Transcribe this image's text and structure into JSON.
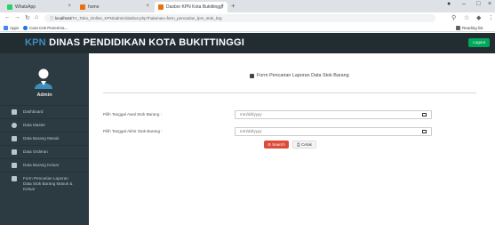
{
  "browser": {
    "tabs": [
      {
        "label": "WhatsApp",
        "favicon_color": "#25d366"
      },
      {
        "label": "home",
        "favicon_color": "#e8710a"
      },
      {
        "label": "Dasbor KPN Kota Bukittinggi",
        "favicon_color": "#e8710a"
      }
    ],
    "url_host": "localhost",
    "url_path": "/TA_Toko_Online_KPN/admin/dasbor.php?halaman=form_pencarian_lpm_stok_brg",
    "bookmarks": [
      {
        "label": "Apps",
        "color": "#4285f4"
      },
      {
        "label": "Cara Cek Penerima...",
        "color": "#1a73e8"
      }
    ],
    "reading_list": "Reading list"
  },
  "header": {
    "brand_prefix": "KPN",
    "brand_rest": " DINAS PENDIDIKAN KOTA BUKITTINGGI",
    "logout_label": "Logout"
  },
  "sidebar": {
    "user_name": "Admin",
    "items": [
      {
        "label": "Dashboard",
        "icon": "dashboard-icon"
      },
      {
        "label": "Data Master",
        "icon": "database-icon"
      },
      {
        "label": "Data Barang Masuk",
        "icon": "file-icon"
      },
      {
        "label": "Data Orderan",
        "icon": "file-icon"
      },
      {
        "label": "Data Barang Keluar",
        "icon": "file-icon"
      },
      {
        "label": "Form Pencarian Laporan Data Stok Barang Masuk & Keluar",
        "icon": "file-icon"
      }
    ]
  },
  "form": {
    "title": "Form Pencarian Laporan Data Stok Barang",
    "start_label": "Pilih Tanggal Awal Stok Barang :",
    "end_label": "Pilih Tanggal Akhir Stok Barang :",
    "start_placeholder": "mm/dd/yyyy",
    "end_placeholder": "mm/dd/yyyy",
    "search_label": "Search",
    "print_label": "Cetak"
  }
}
